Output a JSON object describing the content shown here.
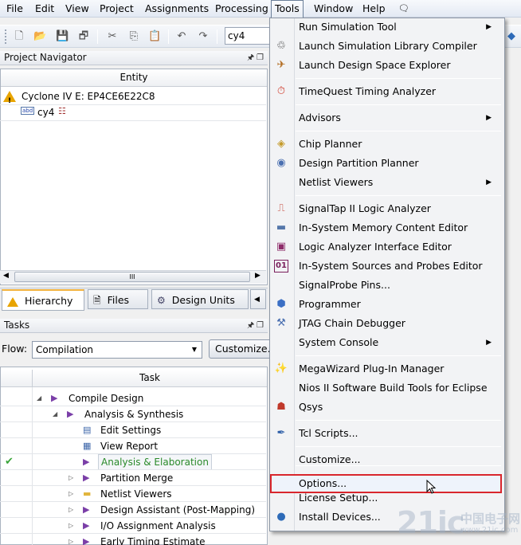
{
  "menubar": {
    "items": [
      "File",
      "Edit",
      "View",
      "Project",
      "Assignments",
      "Processing",
      "Tools",
      "Window",
      "Help"
    ]
  },
  "toolbar": {
    "entity_combo_value": "cy4"
  },
  "project_navigator": {
    "title": "Project Navigator",
    "column_header": "Entity",
    "device": "Cyclone IV E: EP4CE6E22C8",
    "top_entity": "cy4",
    "hscroll_grip": "III",
    "tabs": [
      "Hierarchy",
      "Files",
      "Design Units"
    ]
  },
  "tasks": {
    "title": "Tasks",
    "flow_label": "Flow:",
    "flow_value": "Compilation",
    "customize_button": "Customize...",
    "column_header": "Task",
    "rows": [
      {
        "label": "Compile Design",
        "status": ""
      },
      {
        "label": "Analysis & Synthesis",
        "status": ""
      },
      {
        "label": "Edit Settings",
        "status": ""
      },
      {
        "label": "View Report",
        "status": ""
      },
      {
        "label": "Analysis & Elaboration",
        "status": "done"
      },
      {
        "label": "Partition Merge",
        "status": ""
      },
      {
        "label": "Netlist Viewers",
        "status": ""
      },
      {
        "label": "Design Assistant (Post-Mapping)",
        "status": ""
      },
      {
        "label": "I/O Assignment Analysis",
        "status": ""
      },
      {
        "label": "Early Timing Estimate",
        "status": ""
      }
    ]
  },
  "tools_menu": {
    "items": [
      {
        "label": "Run Simulation Tool",
        "submenu": true,
        "icon": "none"
      },
      {
        "label": "Launch Simulation Library Compiler",
        "submenu": false,
        "icon": "simlib-icon"
      },
      {
        "label": "Launch Design Space Explorer",
        "submenu": false,
        "icon": "dse-icon"
      },
      {
        "label": "TimeQuest Timing Analyzer",
        "submenu": false,
        "icon": "stopwatch-icon"
      },
      {
        "label": "Advisors",
        "submenu": true,
        "icon": "none"
      },
      {
        "label": "Chip Planner",
        "submenu": false,
        "icon": "chip-icon"
      },
      {
        "label": "Design Partition Planner",
        "submenu": false,
        "icon": "partition-icon"
      },
      {
        "label": "Netlist Viewers",
        "submenu": true,
        "icon": "none"
      },
      {
        "label": "SignalTap II Logic Analyzer",
        "submenu": false,
        "icon": "signaltap-icon"
      },
      {
        "label": "In-System Memory Content Editor",
        "submenu": false,
        "icon": "memory-icon"
      },
      {
        "label": "Logic Analyzer Interface Editor",
        "submenu": false,
        "icon": "lai-icon"
      },
      {
        "label": "In-System Sources and Probes Editor",
        "submenu": false,
        "icon": "binary-icon"
      },
      {
        "label": "SignalProbe Pins...",
        "submenu": false,
        "icon": "none"
      },
      {
        "label": "Programmer",
        "submenu": false,
        "icon": "programmer-icon"
      },
      {
        "label": "JTAG Chain Debugger",
        "submenu": false,
        "icon": "jtag-icon"
      },
      {
        "label": "System Console",
        "submenu": true,
        "icon": "none"
      },
      {
        "label": "MegaWizard Plug-In Manager",
        "submenu": false,
        "icon": "wand-icon"
      },
      {
        "label": "Nios II Software Build Tools for Eclipse",
        "submenu": false,
        "icon": "none"
      },
      {
        "label": "Qsys",
        "submenu": false,
        "icon": "qsys-icon"
      },
      {
        "label": "Tcl Scripts...",
        "submenu": false,
        "icon": "feather-icon"
      },
      {
        "label": "Customize...",
        "submenu": false,
        "icon": "none"
      },
      {
        "label": "Options...",
        "submenu": false,
        "icon": "none"
      },
      {
        "label": "License Setup...",
        "submenu": false,
        "icon": "none"
      },
      {
        "label": "Install Devices...",
        "submenu": false,
        "icon": "globe-icon"
      }
    ]
  },
  "watermark": {
    "main": "21ic",
    "cn": "中国电子网",
    "url": "www.21ic.com"
  },
  "colors": {
    "highlight_border": "#d9262c",
    "done_text": "#2a8a2a",
    "warning": "#e8a400",
    "arrow_purple": "#7b3fa8"
  }
}
